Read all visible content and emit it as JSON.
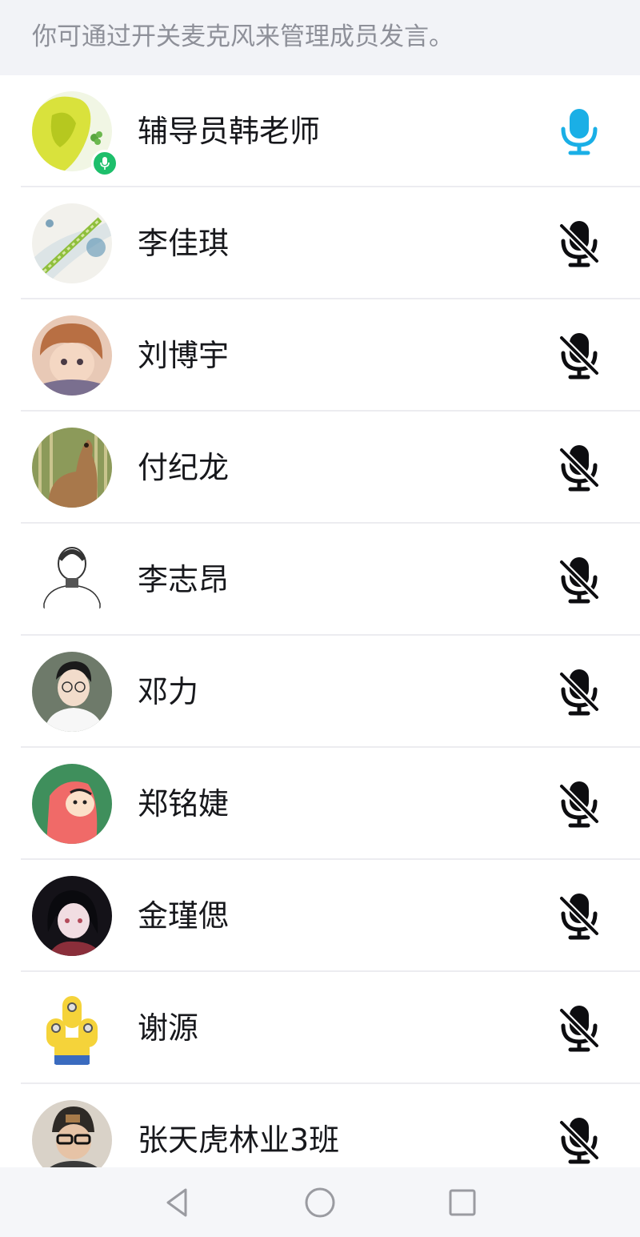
{
  "hint": {
    "text": "你可通过开关麦克风来管理成员发言。"
  },
  "colors": {
    "mic_on": "#1aafe6",
    "mic_off": "#0d0d10",
    "speaking_badge": "#1dbf6b",
    "hint_background": "#f2f3f7"
  },
  "members": [
    {
      "name": "辅导员韩老师",
      "mic": "on",
      "speaking": true,
      "avatar_icon": "yellow-anime-girl-avatar"
    },
    {
      "name": "李佳琪",
      "mic": "off",
      "speaking": false,
      "avatar_icon": "bamboo-art-avatar"
    },
    {
      "name": "刘博宇",
      "mic": "off",
      "speaking": false,
      "avatar_icon": "anime-boy-avatar"
    },
    {
      "name": "付纪龙",
      "mic": "off",
      "speaking": false,
      "avatar_icon": "deer-avatar"
    },
    {
      "name": "李志昂",
      "mic": "off",
      "speaking": false,
      "avatar_icon": "sketch-person-avatar"
    },
    {
      "name": "邓力",
      "mic": "off",
      "speaking": false,
      "avatar_icon": "young-man-glasses-avatar"
    },
    {
      "name": "郑铭婕",
      "mic": "off",
      "speaking": false,
      "avatar_icon": "cartoon-pink-hoodie-avatar"
    },
    {
      "name": "金瑾偲",
      "mic": "off",
      "speaking": false,
      "avatar_icon": "anime-girl-dark-avatar"
    },
    {
      "name": "谢源",
      "mic": "off",
      "speaking": false,
      "avatar_icon": "minions-avatar"
    },
    {
      "name": "张天虎林业3班",
      "mic": "off",
      "speaking": false,
      "avatar_icon": "man-with-beanie-avatar"
    }
  ],
  "nav": {
    "back_icon": "triangle-back-icon",
    "home_icon": "circle-home-icon",
    "recent_icon": "square-recent-icon"
  }
}
